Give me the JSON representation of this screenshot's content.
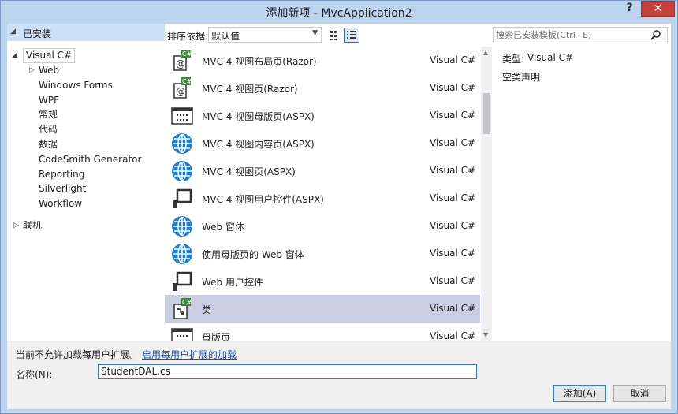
{
  "window": {
    "title": "添加新项 - MvcApplication2",
    "help_label": "?",
    "close_label": "✕"
  },
  "tree": {
    "header": "已安装",
    "items": [
      {
        "label": "Visual C#",
        "level": 0,
        "expanded": true,
        "selected": true
      },
      {
        "label": "Web",
        "level": 1,
        "collapsed": true
      },
      {
        "label": "Windows Forms",
        "level": 1
      },
      {
        "label": "WPF",
        "level": 1
      },
      {
        "label": "常规",
        "level": 1
      },
      {
        "label": "代码",
        "level": 1
      },
      {
        "label": "数据",
        "level": 1
      },
      {
        "label": "CodeSmith Generator",
        "level": 1
      },
      {
        "label": "Reporting",
        "level": 1
      },
      {
        "label": "Silverlight",
        "level": 1
      },
      {
        "label": "Workflow",
        "level": 1
      },
      {
        "label": "联机",
        "level": 0,
        "collapsed": true
      }
    ]
  },
  "toolbar": {
    "sort_label": "排序依据:",
    "sort_value": "默认值",
    "view_small_icons": "grid-view-icon",
    "view_list": "list-view-icon"
  },
  "search": {
    "placeholder": "搜索已安装模板(Ctrl+E)"
  },
  "templates": [
    {
      "name": "MVC 4 视图布局页(Razor)",
      "lang": "Visual C#",
      "icon": "razor-page-icon"
    },
    {
      "name": "MVC 4 视图页(Razor)",
      "lang": "Visual C#",
      "icon": "razor-page-icon"
    },
    {
      "name": "MVC 4 视图母版页(ASPX)",
      "lang": "Visual C#",
      "icon": "master-page-icon"
    },
    {
      "name": "MVC 4 视图内容页(ASPX)",
      "lang": "Visual C#",
      "icon": "globe-icon"
    },
    {
      "name": "MVC 4 视图页(ASPX)",
      "lang": "Visual C#",
      "icon": "globe-icon"
    },
    {
      "name": "MVC 4 视图用户控件(ASPX)",
      "lang": "Visual C#",
      "icon": "user-control-icon"
    },
    {
      "name": "Web 窗体",
      "lang": "Visual C#",
      "icon": "globe-icon"
    },
    {
      "name": "使用母版页的 Web 窗体",
      "lang": "Visual C#",
      "icon": "globe-icon"
    },
    {
      "name": "Web 用户控件",
      "lang": "Visual C#",
      "icon": "user-control-icon"
    },
    {
      "name": "类",
      "lang": "Visual C#",
      "icon": "class-icon",
      "selected": true
    },
    {
      "name": "母版页",
      "lang": "Visual C#",
      "icon": "master-page-icon"
    }
  ],
  "details": {
    "type_label": "类型:",
    "type_value": "Visual C#",
    "description": "空类声明"
  },
  "bottom": {
    "notice": "当前不允许加载每用户扩展。",
    "notice_link": "启用每用户扩展的加载",
    "name_label": "名称(N):",
    "name_value": "StudentDAL.cs",
    "add_label": "添加(A)",
    "cancel_label": "取消"
  },
  "colors": {
    "accent": "#3e6db5",
    "selection": "#c9cfe0",
    "globe": "#1c7fd6",
    "close": "#c7403a"
  }
}
